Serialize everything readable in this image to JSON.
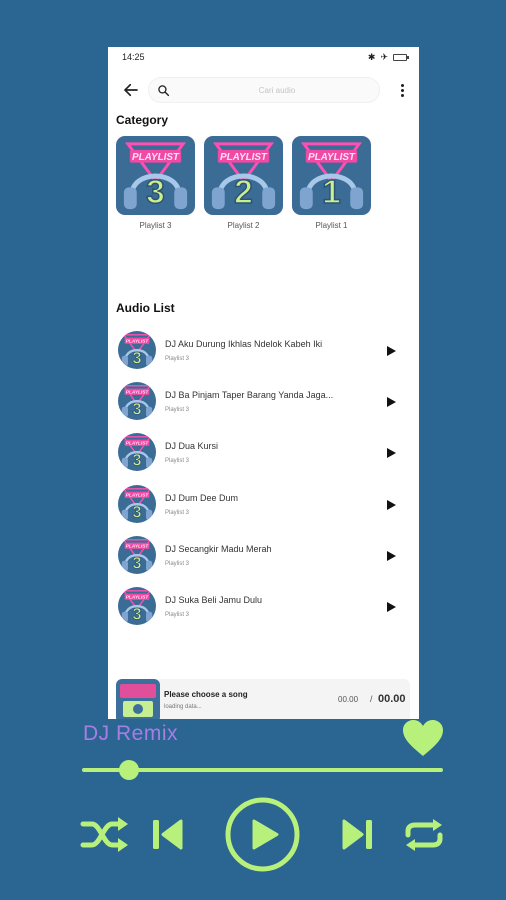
{
  "status": {
    "time": "14:25"
  },
  "search": {
    "placeholder": "Cari audio"
  },
  "category": {
    "title": "Category",
    "items": [
      {
        "label": "Playlist 3",
        "number": "3",
        "badge": "PLAYLIST"
      },
      {
        "label": "Playlist 2",
        "number": "2",
        "badge": "PLAYLIST"
      },
      {
        "label": "Playlist 1",
        "number": "1",
        "badge": "PLAYLIST"
      }
    ]
  },
  "audio_list": {
    "title": "Audio List",
    "items": [
      {
        "title": "DJ Aku Durung Ikhlas Ndelok Kabeh Iki",
        "playlist": "Playlist 3"
      },
      {
        "title": "DJ Ba Pinjam Taper Barang Yanda Jaga...",
        "playlist": "Playlist 3"
      },
      {
        "title": "DJ Dua Kursi",
        "playlist": "Playlist 3"
      },
      {
        "title": "DJ Dum Dee Dum",
        "playlist": "Playlist 3"
      },
      {
        "title": "DJ Secangkir Madu Merah",
        "playlist": "Playlist 3"
      },
      {
        "title": "DJ Suka Beli Jamu Dulu",
        "playlist": "Playlist 3"
      }
    ]
  },
  "mini_player": {
    "title": "Please choose a song",
    "subtitle": "loading data...",
    "current_time": "00.00",
    "separator": "/",
    "total_time": "00.00"
  },
  "player": {
    "app_title": "DJ Remix",
    "progress": 0.13
  },
  "colors": {
    "background": "#2b6592",
    "accent_green": "#b8f07c",
    "title_purple": "#a77de6"
  },
  "icons": [
    "back-arrow-icon",
    "search-icon",
    "more-vert-icon",
    "play-icon",
    "heart-icon",
    "shuffle-icon",
    "skip-previous-icon",
    "play-circle-icon",
    "skip-next-icon",
    "repeat-icon"
  ]
}
